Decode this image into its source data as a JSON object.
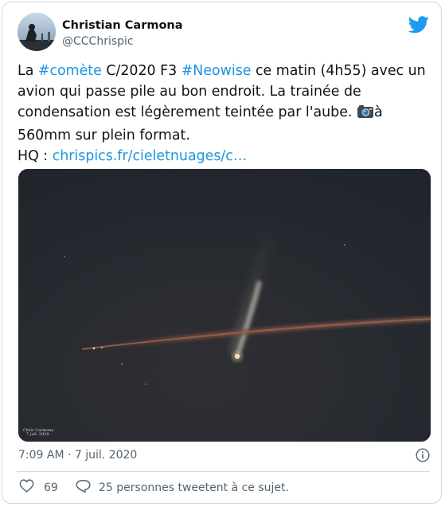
{
  "author": {
    "name": "Christian Carmona",
    "handle": "@CCChrispic",
    "avatar_icon": "avatar-photo"
  },
  "tweet": {
    "text_1": "La ",
    "hashtag_1": "#comète",
    "text_2": " C/2020 F3 ",
    "hashtag_2": "#Neowise",
    "text_3": " ce matin (4h55) avec un avion qui passe pile au bon endroit. La trainée de condensation est légèrement teintée par l'aube. ",
    "camera_icon": "camera-emoji",
    "text_4": "à 560mm sur plein format.",
    "hq_label": "HQ : ",
    "link": "chrispics.fr/cieletnuages/c…"
  },
  "photo": {
    "watermark_line1": "Chris Carmona",
    "watermark_line2": "7 juil. 2020"
  },
  "meta": {
    "timestamp": "7:09 AM · 7 juil. 2020"
  },
  "actions": {
    "like_count": "69",
    "reply_text": "25 personnes tweetent à ce sujet."
  },
  "colors": {
    "link": "#1b95e0",
    "twitter_blue": "#1d9bf0",
    "secondary_text": "#536471",
    "border": "#cfd9de",
    "sky": "#22272d"
  },
  "icons": [
    "twitter-bird-icon",
    "camera-icon",
    "info-icon",
    "heart-icon",
    "speech-bubble-icon"
  ]
}
